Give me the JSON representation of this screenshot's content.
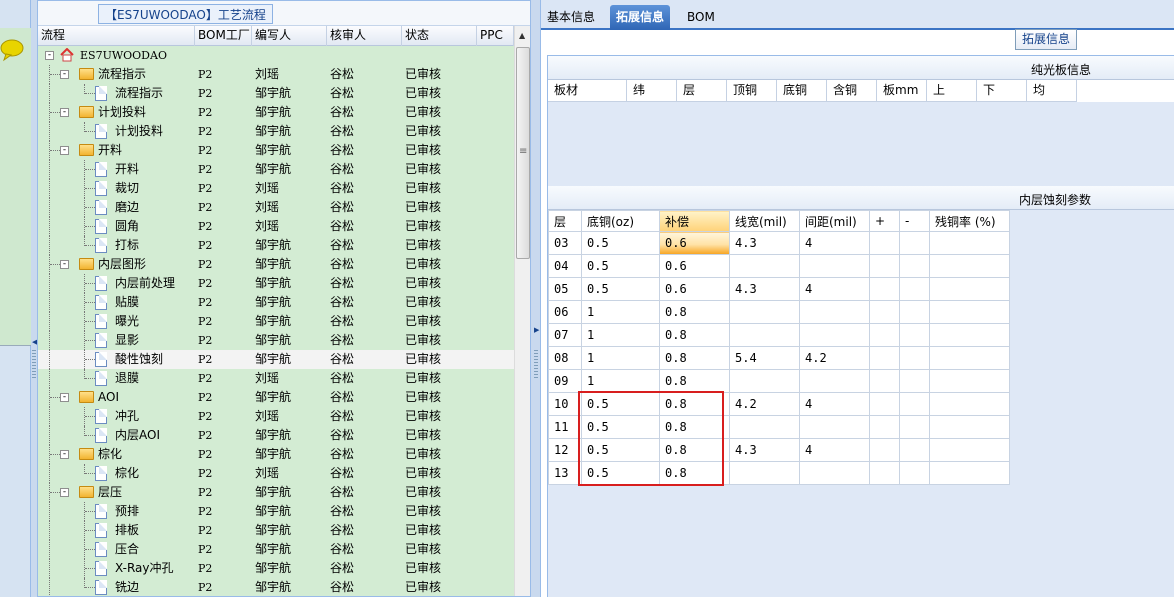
{
  "tree_panel": {
    "title": "【ES7UWOODAO】工艺流程",
    "columns": [
      "流程",
      "BOM工厂",
      "编写人",
      "核审人",
      "状态",
      "PPC"
    ],
    "rows": [
      {
        "name": "ES7UWOODAO",
        "bom": "",
        "writer": "",
        "reviewer": "",
        "status": "",
        "type": "root",
        "depth": 0
      },
      {
        "name": "流程指示",
        "bom": "P2",
        "writer": "刘瑶",
        "reviewer": "谷松",
        "status": "已审核",
        "type": "folder",
        "depth": 1
      },
      {
        "name": "流程指示",
        "bom": "P2",
        "writer": "邹宇航",
        "reviewer": "谷松",
        "status": "已审核",
        "type": "doc",
        "depth": 2
      },
      {
        "name": "计划投料",
        "bom": "P2",
        "writer": "邹宇航",
        "reviewer": "谷松",
        "status": "已审核",
        "type": "folder",
        "depth": 1
      },
      {
        "name": "计划投料",
        "bom": "P2",
        "writer": "邹宇航",
        "reviewer": "谷松",
        "status": "已审核",
        "type": "doc",
        "depth": 2
      },
      {
        "name": "开料",
        "bom": "P2",
        "writer": "邹宇航",
        "reviewer": "谷松",
        "status": "已审核",
        "type": "folder",
        "depth": 1
      },
      {
        "name": "开料",
        "bom": "P2",
        "writer": "邹宇航",
        "reviewer": "谷松",
        "status": "已审核",
        "type": "doc",
        "depth": 2
      },
      {
        "name": "裁切",
        "bom": "P2",
        "writer": "刘瑶",
        "reviewer": "谷松",
        "status": "已审核",
        "type": "doc",
        "depth": 2
      },
      {
        "name": "磨边",
        "bom": "P2",
        "writer": "刘瑶",
        "reviewer": "谷松",
        "status": "已审核",
        "type": "doc",
        "depth": 2
      },
      {
        "name": "圆角",
        "bom": "P2",
        "writer": "刘瑶",
        "reviewer": "谷松",
        "status": "已审核",
        "type": "doc",
        "depth": 2
      },
      {
        "name": "打标",
        "bom": "P2",
        "writer": "邹宇航",
        "reviewer": "谷松",
        "status": "已审核",
        "type": "doc",
        "depth": 2
      },
      {
        "name": "内层图形",
        "bom": "P2",
        "writer": "邹宇航",
        "reviewer": "谷松",
        "status": "已审核",
        "type": "folder",
        "depth": 1
      },
      {
        "name": "内层前处理",
        "bom": "P2",
        "writer": "邹宇航",
        "reviewer": "谷松",
        "status": "已审核",
        "type": "doc",
        "depth": 2
      },
      {
        "name": "贴膜",
        "bom": "P2",
        "writer": "邹宇航",
        "reviewer": "谷松",
        "status": "已审核",
        "type": "doc",
        "depth": 2
      },
      {
        "name": "曝光",
        "bom": "P2",
        "writer": "邹宇航",
        "reviewer": "谷松",
        "status": "已审核",
        "type": "doc",
        "depth": 2
      },
      {
        "name": "显影",
        "bom": "P2",
        "writer": "邹宇航",
        "reviewer": "谷松",
        "status": "已审核",
        "type": "doc",
        "depth": 2
      },
      {
        "name": "酸性蚀刻",
        "bom": "P2",
        "writer": "邹宇航",
        "reviewer": "谷松",
        "status": "已审核",
        "type": "doc",
        "depth": 2,
        "selected": true
      },
      {
        "name": "退膜",
        "bom": "P2",
        "writer": "刘瑶",
        "reviewer": "谷松",
        "status": "已审核",
        "type": "doc",
        "depth": 2
      },
      {
        "name": "AOI",
        "bom": "P2",
        "writer": "邹宇航",
        "reviewer": "谷松",
        "status": "已审核",
        "type": "folder",
        "depth": 1
      },
      {
        "name": "冲孔",
        "bom": "P2",
        "writer": "刘瑶",
        "reviewer": "谷松",
        "status": "已审核",
        "type": "doc",
        "depth": 2
      },
      {
        "name": "内层AOI",
        "bom": "P2",
        "writer": "邹宇航",
        "reviewer": "谷松",
        "status": "已审核",
        "type": "doc",
        "depth": 2
      },
      {
        "name": "棕化",
        "bom": "P2",
        "writer": "邹宇航",
        "reviewer": "谷松",
        "status": "已审核",
        "type": "folder",
        "depth": 1
      },
      {
        "name": "棕化",
        "bom": "P2",
        "writer": "刘瑶",
        "reviewer": "谷松",
        "status": "已审核",
        "type": "doc",
        "depth": 2
      },
      {
        "name": "层压",
        "bom": "P2",
        "writer": "邹宇航",
        "reviewer": "谷松",
        "status": "已审核",
        "type": "folder",
        "depth": 1
      },
      {
        "name": "预排",
        "bom": "P2",
        "writer": "邹宇航",
        "reviewer": "谷松",
        "status": "已审核",
        "type": "doc",
        "depth": 2
      },
      {
        "name": "排板",
        "bom": "P2",
        "writer": "邹宇航",
        "reviewer": "谷松",
        "status": "已审核",
        "type": "doc",
        "depth": 2
      },
      {
        "name": "压合",
        "bom": "P2",
        "writer": "邹宇航",
        "reviewer": "谷松",
        "status": "已审核",
        "type": "doc",
        "depth": 2
      },
      {
        "name": "X-Ray冲孔",
        "bom": "P2",
        "writer": "邹宇航",
        "reviewer": "谷松",
        "status": "已审核",
        "type": "doc",
        "depth": 2
      },
      {
        "name": "铣边",
        "bom": "P2",
        "writer": "邹宇航",
        "reviewer": "谷松",
        "status": "已审核",
        "type": "doc",
        "depth": 2
      }
    ]
  },
  "tabs": [
    {
      "label": "基本信息",
      "active": false
    },
    {
      "label": "拓展信息",
      "active": true
    },
    {
      "label": "BOM",
      "active": false
    }
  ],
  "ext_info_button": "拓展信息",
  "pure_board": {
    "title": "纯光板信息",
    "columns": [
      "板材",
      "纬",
      "层",
      "顶铜",
      "底铜",
      "含铜",
      "板mm",
      "上",
      "下",
      "均"
    ]
  },
  "inner_etch": {
    "title": "内层蚀刻参数",
    "columns": [
      "层",
      "底铜(oz)",
      "补偿",
      "线宽(mil)",
      "间距(mil)",
      "+",
      "-",
      "残铜率 (%)"
    ],
    "rows": [
      [
        "03",
        "0.5",
        "0.6",
        "4.3",
        "4",
        "",
        "",
        ""
      ],
      [
        "04",
        "0.5",
        "0.6",
        "",
        "",
        "",
        "",
        ""
      ],
      [
        "05",
        "0.5",
        "0.6",
        "4.3",
        "4",
        "",
        "",
        ""
      ],
      [
        "06",
        "1",
        "0.8",
        "",
        "",
        "",
        "",
        ""
      ],
      [
        "07",
        "1",
        "0.8",
        "",
        "",
        "",
        "",
        ""
      ],
      [
        "08",
        "1",
        "0.8",
        "5.4",
        "4.2",
        "",
        "",
        ""
      ],
      [
        "09",
        "1",
        "0.8",
        "",
        "",
        "",
        "",
        ""
      ],
      [
        "10",
        "0.5",
        "0.8",
        "4.2",
        "4",
        "",
        "",
        ""
      ],
      [
        "11",
        "0.5",
        "0.8",
        "",
        "",
        "",
        "",
        ""
      ],
      [
        "12",
        "0.5",
        "0.8",
        "4.3",
        "4",
        "",
        "",
        ""
      ],
      [
        "13",
        "0.5",
        "0.8",
        "",
        "",
        "",
        "",
        ""
      ]
    ]
  },
  "colors": {
    "tree_row_bg": "#d3ecd3",
    "active_tab": "#2f66b5",
    "highlight_box": "#d81e1e"
  }
}
